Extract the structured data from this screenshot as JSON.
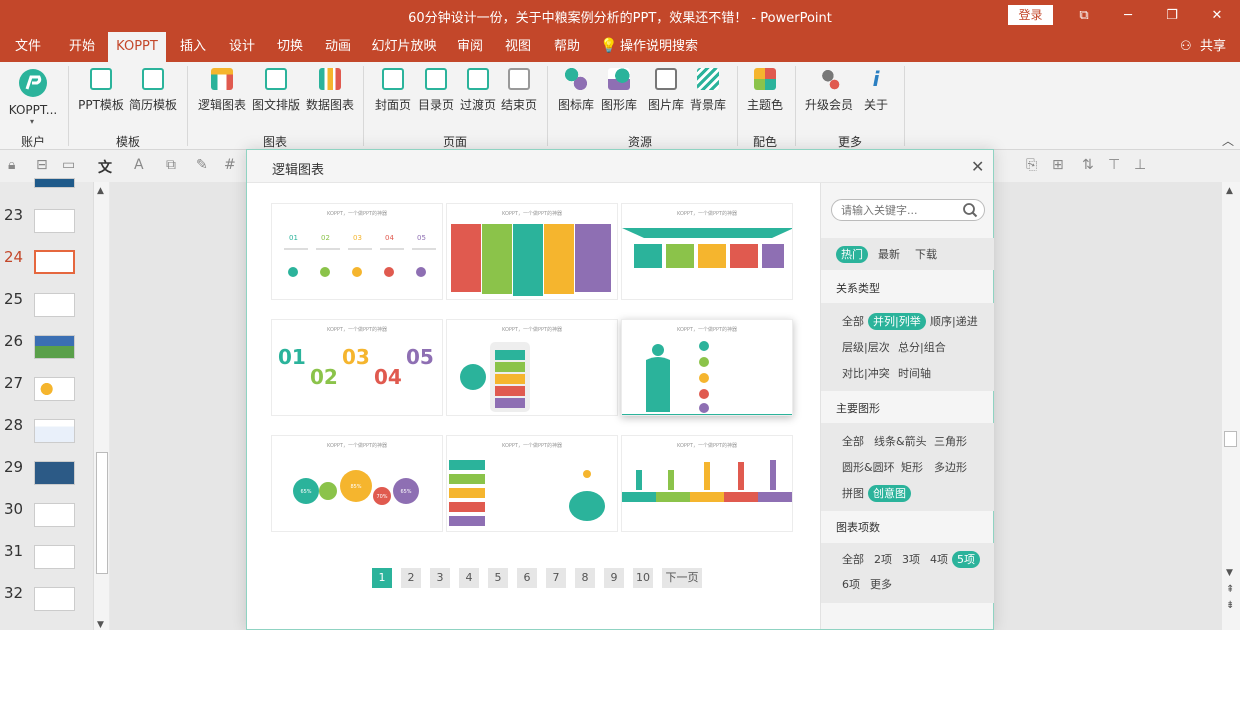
{
  "window": {
    "title": "60分钟设计一份，关于中粮案例分析的PPT，效果还不错！ - PowerPoint",
    "login": "登录"
  },
  "menu": {
    "tabs": [
      "文件",
      "开始",
      "KOPPT",
      "插入",
      "设计",
      "切换",
      "动画",
      "幻灯片放映",
      "审阅",
      "视图",
      "帮助",
      "操作说明搜索"
    ],
    "active": "KOPPT",
    "share": "共享"
  },
  "ribbon": {
    "buttons": [
      "KOPPT...",
      "PPT模板",
      "简历模板",
      "逻辑图表",
      "图文排版",
      "数据图表",
      "封面页",
      "目录页",
      "过渡页",
      "结束页",
      "图标库",
      "图形库",
      "图片库",
      "背景库",
      "主题色",
      "升级会员",
      "关于"
    ],
    "groups": [
      "账户",
      "模板",
      "图表",
      "页面",
      "资源",
      "配色",
      "更多"
    ]
  },
  "slides": {
    "numbers": [
      "23",
      "24",
      "25",
      "26",
      "27",
      "28",
      "29",
      "30",
      "31",
      "32"
    ],
    "current": "24"
  },
  "dialog": {
    "title": "逻辑图表",
    "card_caption": "KOPPT，一个做PPT的神器",
    "search_placeholder": "请输入关键字...",
    "sort_tabs": [
      "热门",
      "最新",
      "下载"
    ],
    "relation": {
      "heading": "关系类型",
      "items": [
        "全部",
        "并列|列举",
        "顺序|递进",
        "层级|层次",
        "总分|组合",
        "对比|冲突",
        "时间轴"
      ],
      "selected": "并列|列举"
    },
    "shape": {
      "heading": "主要图形",
      "items": [
        "全部",
        "线条&箭头",
        "三角形",
        "圆形&圆环",
        "矩形",
        "多边形",
        "拼图",
        "创意图"
      ],
      "selected": "创意图"
    },
    "count": {
      "heading": "图表项数",
      "items": [
        "全部",
        "2项",
        "3项",
        "4项",
        "5项",
        "6项",
        "更多"
      ],
      "selected": "5项"
    },
    "pager": {
      "pages": [
        "1",
        "2",
        "3",
        "4",
        "5",
        "6",
        "7",
        "8",
        "9",
        "10"
      ],
      "current": "1",
      "next": "下一页"
    },
    "card1_nums": [
      "01",
      "02",
      "03",
      "04",
      "05"
    ],
    "card4_nums": [
      "01",
      "02",
      "03",
      "04",
      "05"
    ],
    "gear_pcts": [
      "65%",
      "85%",
      "70%",
      "65%"
    ]
  },
  "colors": {
    "brand": "#c3472a",
    "accent": "#2bb39b",
    "green": "#8bc34a",
    "yellow": "#f5b52e",
    "red": "#e05a4f",
    "purple": "#8e6fb3"
  }
}
